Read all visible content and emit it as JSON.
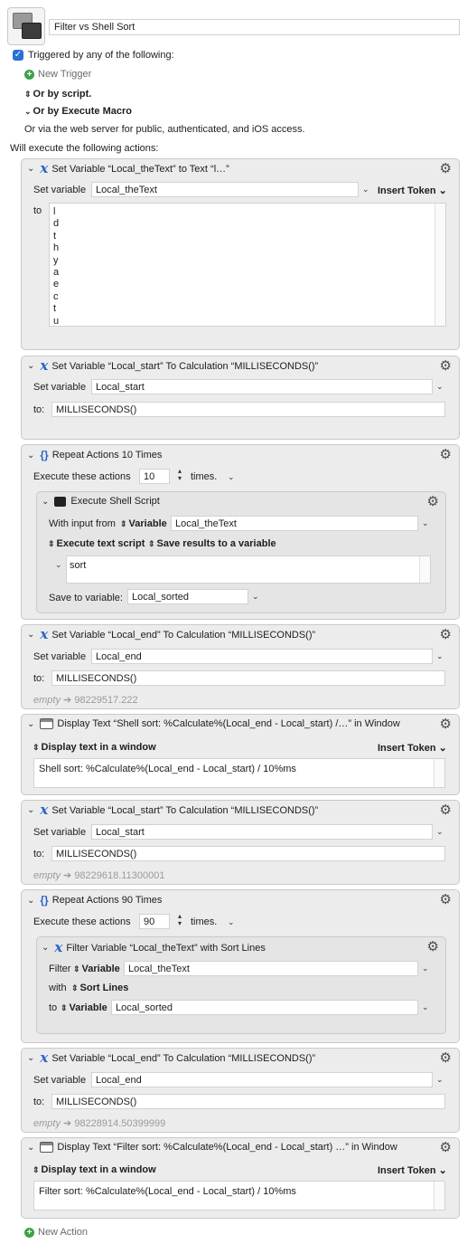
{
  "macro": {
    "name": "Filter vs Shell Sort",
    "triggered_label": "Triggered by any of the following:",
    "new_trigger": "New Trigger",
    "or_by_script": "Or by script.",
    "or_by_execute_macro": "Or by Execute Macro",
    "web_server_text": "Or via the web server for public, authenticated, and iOS access.",
    "will_execute": "Will execute the following actions:",
    "new_action": "New Action"
  },
  "actions": {
    "a1": {
      "title": "Set Variable “Local_theText” to Text “l…”",
      "set_variable_label": "Set variable",
      "variable": "Local_theText",
      "insert_token": "Insert Token",
      "to_label": "to",
      "lines": [
        "l",
        "d",
        "t",
        "h",
        "y",
        "a",
        "e",
        "c",
        "t",
        "u"
      ]
    },
    "a2": {
      "title": "Set Variable “Local_start” To Calculation “MILLISECONDS()”",
      "set_variable_label": "Set variable",
      "variable": "Local_start",
      "to_label": "to:",
      "calculation": "MILLISECONDS()"
    },
    "a3": {
      "title": "Repeat Actions 10 Times",
      "execute_label": "Execute these actions",
      "count": "10",
      "times_label": "times.",
      "shell": {
        "title": "Execute Shell Script",
        "with_input_from": "With input from",
        "variable_label": "Variable",
        "variable": "Local_theText",
        "execute_text_script": "Execute text script",
        "save_results": "Save results to a variable",
        "script": "sort",
        "save_to_label": "Save to variable:",
        "save_to": "Local_sorted"
      }
    },
    "a4": {
      "title": "Set Variable “Local_end” To Calculation “MILLISECONDS()”",
      "set_variable_label": "Set variable",
      "variable": "Local_end",
      "to_label": "to:",
      "calculation": "MILLISECONDS()",
      "result_empty": "empty",
      "result_arrow": "➔",
      "result_value": "98229517.222"
    },
    "a5": {
      "title": "Display Text “Shell sort: %Calculate%(Local_end - Local_start) /…” in Window",
      "display_mode": "Display text in a window",
      "insert_token": "Insert Token",
      "text": "Shell sort: %Calculate%(Local_end - Local_start) / 10%ms"
    },
    "a6": {
      "title": "Set Variable “Local_start” To Calculation “MILLISECONDS()”",
      "set_variable_label": "Set variable",
      "variable": "Local_start",
      "to_label": "to:",
      "calculation": "MILLISECONDS()",
      "result_empty": "empty",
      "result_arrow": "➔",
      "result_value": "98229618.11300001"
    },
    "a7": {
      "title": "Repeat Actions 90 Times",
      "execute_label": "Execute these actions",
      "count": "90",
      "times_label": "times.",
      "filter": {
        "title": "Filter Variable “Local_theText” with Sort Lines",
        "filter_label": "Filter",
        "variable_label": "Variable",
        "variable": "Local_theText",
        "with_label": "with",
        "sort_lines": "Sort Lines",
        "to_label": "to",
        "to_variable": "Local_sorted"
      }
    },
    "a8": {
      "title": "Set Variable “Local_end” To Calculation “MILLISECONDS()”",
      "set_variable_label": "Set variable",
      "variable": "Local_end",
      "to_label": "to:",
      "calculation": "MILLISECONDS()",
      "result_empty": "empty",
      "result_arrow": "➔",
      "result_value": "98228914.50399999"
    },
    "a9": {
      "title": "Display Text “Filter sort: %Calculate%(Local_end - Local_start) …” in Window",
      "display_mode": "Display text in a window",
      "insert_token": "Insert Token",
      "text": "Filter sort: %Calculate%(Local_end - Local_start) / 10%ms"
    }
  }
}
